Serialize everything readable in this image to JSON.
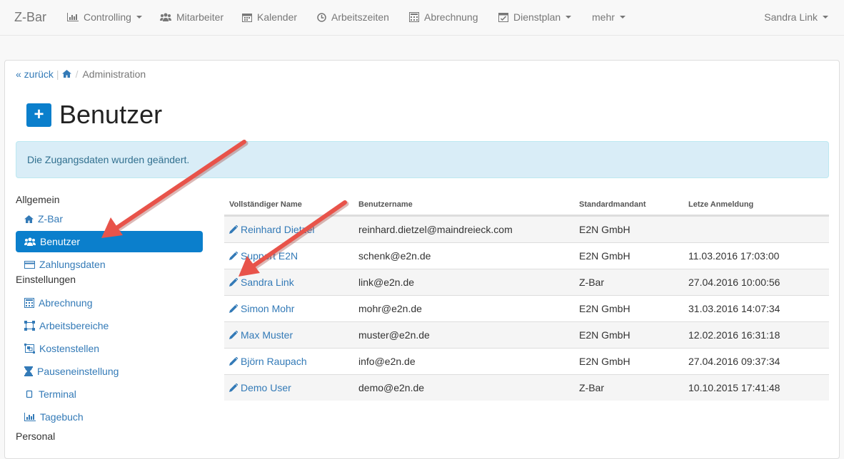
{
  "navbar": {
    "brand": "Z-Bar",
    "items": [
      {
        "label": "Controlling",
        "icon": "bar-chart-icon",
        "dropdown": true
      },
      {
        "label": "Mitarbeiter",
        "icon": "users-icon",
        "dropdown": false
      },
      {
        "label": "Kalender",
        "icon": "calendar-icon",
        "dropdown": false
      },
      {
        "label": "Arbeitszeiten",
        "icon": "clock-icon",
        "dropdown": false
      },
      {
        "label": "Abrechnung",
        "icon": "calculator-icon",
        "dropdown": false
      },
      {
        "label": "Dienstplan",
        "icon": "calendar-check-icon",
        "dropdown": true
      },
      {
        "label": "mehr",
        "icon": "",
        "dropdown": true
      }
    ],
    "user": "Sandra Link"
  },
  "breadcrumb": {
    "back": "« zurück",
    "current": "Administration"
  },
  "page": {
    "title": "Benutzer",
    "add_button": "+"
  },
  "alert": {
    "message": "Die Zugangsdaten wurden geändert."
  },
  "sidebar": {
    "sections": [
      {
        "heading": "Allgemein",
        "items": [
          {
            "label": "Z-Bar",
            "icon": "home-icon",
            "active": false
          },
          {
            "label": "Benutzer",
            "icon": "users-icon",
            "active": true
          },
          {
            "label": "Zahlungsdaten",
            "icon": "credit-card-icon",
            "active": false
          }
        ]
      },
      {
        "heading": "Einstellungen",
        "items": [
          {
            "label": "Abrechnung",
            "icon": "calculator-icon",
            "active": false
          },
          {
            "label": "Arbeitsbereiche",
            "icon": "vector-square-icon",
            "active": false
          },
          {
            "label": "Kostenstellen",
            "icon": "object-group-icon",
            "active": false
          },
          {
            "label": "Pauseneinstellung",
            "icon": "hourglass-icon",
            "active": false
          },
          {
            "label": "Terminal",
            "icon": "tablet-icon",
            "active": false
          },
          {
            "label": "Tagebuch",
            "icon": "bar-chart-icon",
            "active": false
          }
        ]
      },
      {
        "heading": "Personal",
        "items": []
      }
    ]
  },
  "table": {
    "headers": [
      "Vollständiger Name",
      "Benutzername",
      "Standardmandant",
      "Letze Anmeldung"
    ],
    "rows": [
      {
        "name": "Reinhard Dietzel",
        "username": "reinhard.dietzel@maindreieck.com",
        "mandant": "E2N GmbH",
        "last_login": ""
      },
      {
        "name": "Support E2N",
        "username": "schenk@e2n.de",
        "mandant": "E2N GmbH",
        "last_login": "11.03.2016 17:03:00"
      },
      {
        "name": "Sandra Link",
        "username": "link@e2n.de",
        "mandant": "Z-Bar",
        "last_login": "27.04.2016 10:00:56"
      },
      {
        "name": "Simon Mohr",
        "username": "mohr@e2n.de",
        "mandant": "E2N GmbH",
        "last_login": "31.03.2016 14:07:34"
      },
      {
        "name": "Max Muster",
        "username": "muster@e2n.de",
        "mandant": "E2N GmbH",
        "last_login": "12.02.2016 16:31:18"
      },
      {
        "name": "Björn Raupach",
        "username": "info@e2n.de",
        "mandant": "E2N GmbH",
        "last_login": "27.04.2016 09:37:34"
      },
      {
        "name": "Demo User",
        "username": "demo@e2n.de",
        "mandant": "Z-Bar",
        "last_login": "10.10.2015 17:41:48"
      }
    ]
  },
  "colors": {
    "accent": "#0b7fcc",
    "link": "#337ab7",
    "alert_bg": "#d9edf7",
    "annotation_arrow": "#e8534a"
  }
}
